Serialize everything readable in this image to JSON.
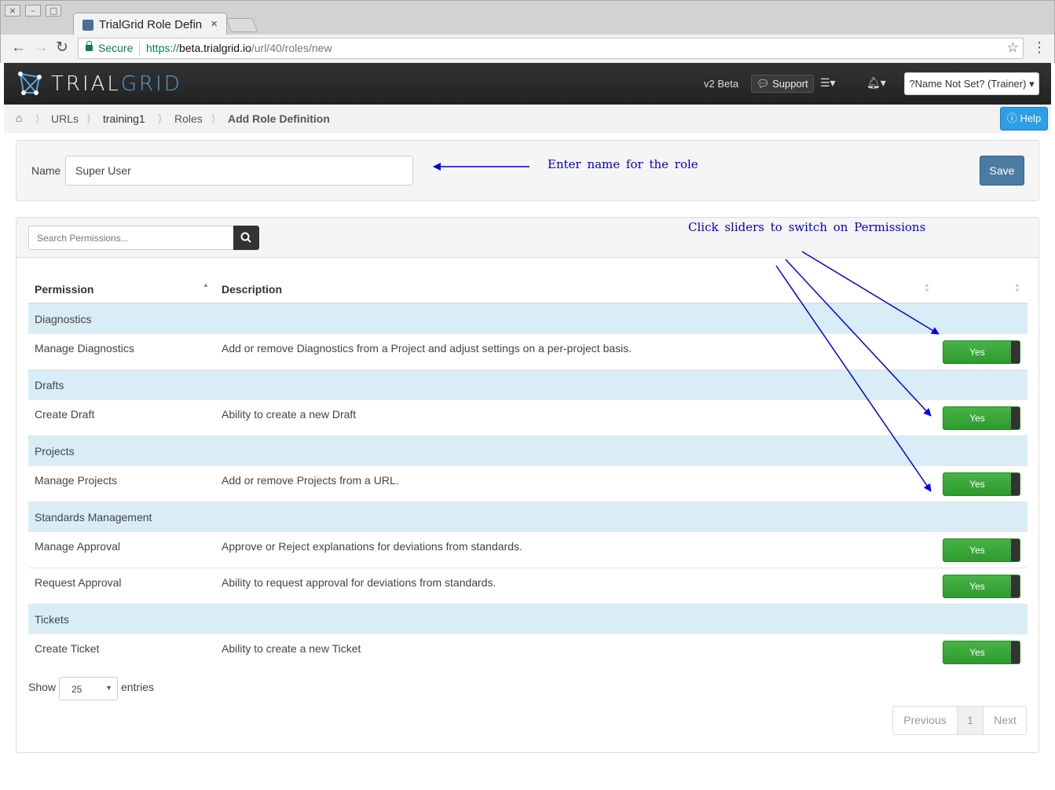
{
  "browser": {
    "tab_title": "TrialGrid Role Defin",
    "tab_close": "×",
    "win_close": "⨯",
    "win_min": "–",
    "win_max": "□",
    "back": "←",
    "forward": "→",
    "reload": "↻",
    "secure_label": "Secure",
    "url_scheme": "https://",
    "url_host": "beta.trialgrid.io",
    "url_path": "/url/40/roles/new",
    "star": "☆",
    "menu": "⋮"
  },
  "navbar": {
    "brand_part1": "TRIAL",
    "brand_part2": "GRID",
    "version": "v2 Beta",
    "support_label": "Support",
    "user_label": "?Name Not Set? (Trainer)",
    "brand_color": "#5aa0d8"
  },
  "breadcrumb": {
    "home_icon": "home-icon",
    "items": [
      "URLs",
      "training1",
      "Roles",
      "Add Role Definition"
    ],
    "help_label": "Help"
  },
  "form": {
    "name_label": "Name",
    "name_value": "Super User",
    "save_label": "Save"
  },
  "annotations": {
    "name_hint": "Enter name for the role",
    "slider_hint": "Click sliders to switch on Permissions",
    "color": "#0000cc"
  },
  "permissions": {
    "search_placeholder": "Search Permissions...",
    "columns": [
      "Permission",
      "Description"
    ],
    "toggle_label": "Yes",
    "groups": [
      {
        "name": "Diagnostics",
        "rows": [
          {
            "permission": "Manage Diagnostics",
            "description": "Add or remove Diagnostics from a Project and adjust settings on a per-project basis."
          }
        ]
      },
      {
        "name": "Drafts",
        "rows": [
          {
            "permission": "Create Draft",
            "description": "Ability to create a new Draft"
          }
        ]
      },
      {
        "name": "Projects",
        "rows": [
          {
            "permission": "Manage Projects",
            "description": "Add or remove Projects from a URL."
          }
        ]
      },
      {
        "name": "Standards Management",
        "rows": [
          {
            "permission": "Manage Approval",
            "description": "Approve or Reject explanations for deviations from standards."
          },
          {
            "permission": "Request Approval",
            "description": "Ability to request approval for deviations from standards."
          }
        ]
      },
      {
        "name": "Tickets",
        "rows": [
          {
            "permission": "Create Ticket",
            "description": "Ability to create a new Ticket"
          }
        ]
      }
    ],
    "show_label": "Show",
    "entries_value": "25",
    "entries_label": "entries",
    "pager": {
      "previous": "Previous",
      "page": "1",
      "next": "Next"
    }
  }
}
